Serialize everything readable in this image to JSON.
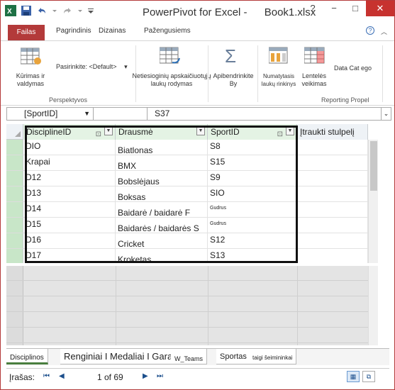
{
  "title": {
    "app": "PowerPivot for Excel -",
    "file": "Book1.xlsx"
  },
  "window_buttons": {
    "help": "?",
    "minimize": "−",
    "maximize": "□",
    "close": "✕"
  },
  "tabs": [
    {
      "label": "Failas"
    },
    {
      "label": "Pagrindinis"
    },
    {
      "label": "Dizainas"
    },
    {
      "label": "Pažengusiems"
    }
  ],
  "ribbon": {
    "perspectives_button": "Kūrimas ir valdymas",
    "perspective_select": "Pasirinkite: <Default>",
    "perspectives_group": "Perspektyvos",
    "implicit_fields": "Netiesioginių apskaičiuotųjų laukų rodymas",
    "summarize_by": "Apibendrinkite By",
    "default_fieldset": "Numatytasis laukų rinkinys",
    "table_behavior": "Lentelės veikimas",
    "data_category": "Data Cat ego",
    "reporting_group": "Reporting Propel"
  },
  "formula_bar": {
    "name_box": "[SportID]",
    "value": "S37"
  },
  "grid": {
    "columns": [
      {
        "name": "DisciplineID"
      },
      {
        "name": "Drausmė"
      },
      {
        "name": "SportID"
      },
      {
        "name": "Įtraukti stulpelį"
      }
    ],
    "rows": [
      {
        "id": "DIO",
        "discipline": "Biatlonas",
        "sport": "S8"
      },
      {
        "id": "Krapai",
        "discipline": "BMX",
        "sport": "S15"
      },
      {
        "id": "D12",
        "discipline": "Bobslėjaus",
        "sport": "S9"
      },
      {
        "id": "D13",
        "discipline": "Boksas",
        "sport": "SIO"
      },
      {
        "id": "D14",
        "discipline": "Baidarė / baidarė F",
        "sport": "Gudrus"
      },
      {
        "id": "D15",
        "discipline": "Baidarės / baidarės S",
        "sport": "Gudrus"
      },
      {
        "id": "D16",
        "discipline": "Cricket",
        "sport": "S12"
      },
      {
        "id": "D17",
        "discipline": "Kroketas",
        "sport": "S13"
      }
    ]
  },
  "sheet_tabs": [
    {
      "label": "Disciplinos"
    },
    {
      "label": "Renginiai I Medaliai I Garaį"
    },
    {
      "label": "W_Teams"
    },
    {
      "label": "Sportas"
    },
    {
      "label": "taigi šeimininkai"
    }
  ],
  "status": {
    "record_label": "Įrašas:",
    "first": "⏮",
    "prev": "◀",
    "position": "1 of 69",
    "next": "▶",
    "last": "⏭",
    "view_grid": "▦",
    "view_diagram": "⧉"
  },
  "colors": {
    "accent": "#b33a3a",
    "selected_header": "#c8e6c8",
    "border_active": "#111111"
  }
}
